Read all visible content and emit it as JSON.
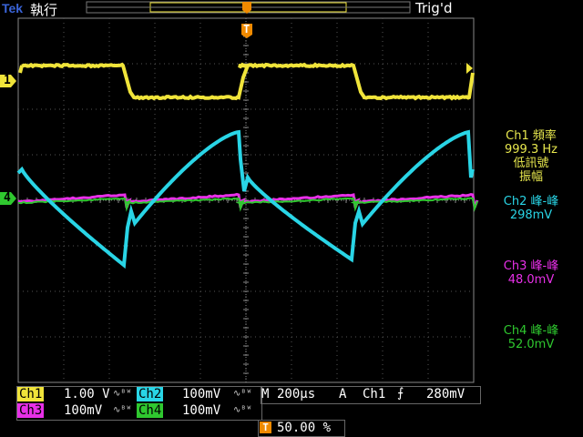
{
  "header": {
    "brand": "Tek",
    "run_state": "執行",
    "trigger_status": "Trig'd"
  },
  "markers": {
    "ch1": "1",
    "ch4": "4",
    "trigger": "T"
  },
  "measurements": {
    "ch1_label": "Ch1 頻率",
    "ch1_value": "999.3 Hz",
    "ch1_note1": "低訊號",
    "ch1_note2": "振幅",
    "ch2_label": "Ch2 峰-峰",
    "ch2_value": "298mV",
    "ch3_label": "Ch3 峰-峰",
    "ch3_value": "48.0mV",
    "ch4_label": "Ch4 峰-峰",
    "ch4_value": "52.0mV"
  },
  "footer": {
    "ch1": "Ch1",
    "ch1_scale": "1.00 V",
    "ch2": "Ch2",
    "ch2_scale": "100mV",
    "ch3": "Ch3",
    "ch3_scale": "100mV",
    "ch4": "Ch4",
    "ch4_scale": "100mV",
    "timebase_label": "M",
    "timebase": "200µs",
    "trigger_mode": "A",
    "trigger_source": "Ch1",
    "trigger_level": "280mV",
    "trigger_position": "50.00 %"
  },
  "colors": {
    "ch1": "#f0e43a",
    "ch2": "#29d5e6",
    "ch3": "#e830e8",
    "ch4": "#2fc82f"
  }
}
